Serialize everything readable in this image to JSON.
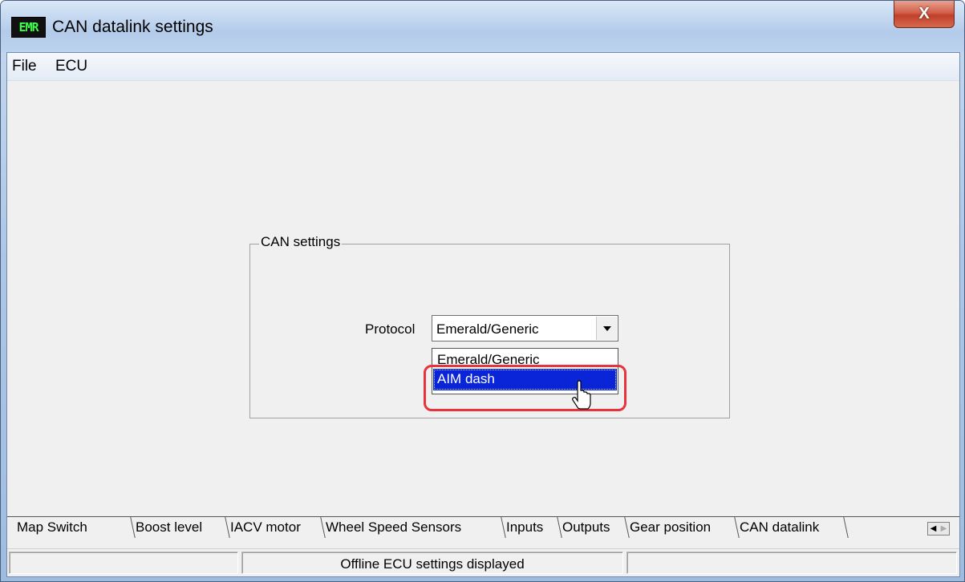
{
  "window": {
    "icon_text": "EMR",
    "title": "CAN datalink settings",
    "close_glyph": "X"
  },
  "menu": {
    "items": [
      "File",
      "ECU"
    ]
  },
  "can_settings": {
    "group_label": "CAN settings",
    "protocol_label": "Protocol",
    "protocol_value": "Emerald/Generic",
    "dropdown_options": [
      "Emerald/Generic",
      "AIM dash"
    ],
    "highlighted_option": "AIM dash"
  },
  "tabs": {
    "items": [
      "Map Switch",
      "Boost level",
      "IACV motor",
      "Wheel Speed Sensors",
      "Inputs",
      "Outputs",
      "Gear position",
      "CAN datalink"
    ],
    "active": "CAN datalink"
  },
  "status": {
    "message": "Offline ECU settings displayed"
  },
  "colors": {
    "selection": "#0a24d8",
    "highlight_ring": "#e8323c"
  }
}
